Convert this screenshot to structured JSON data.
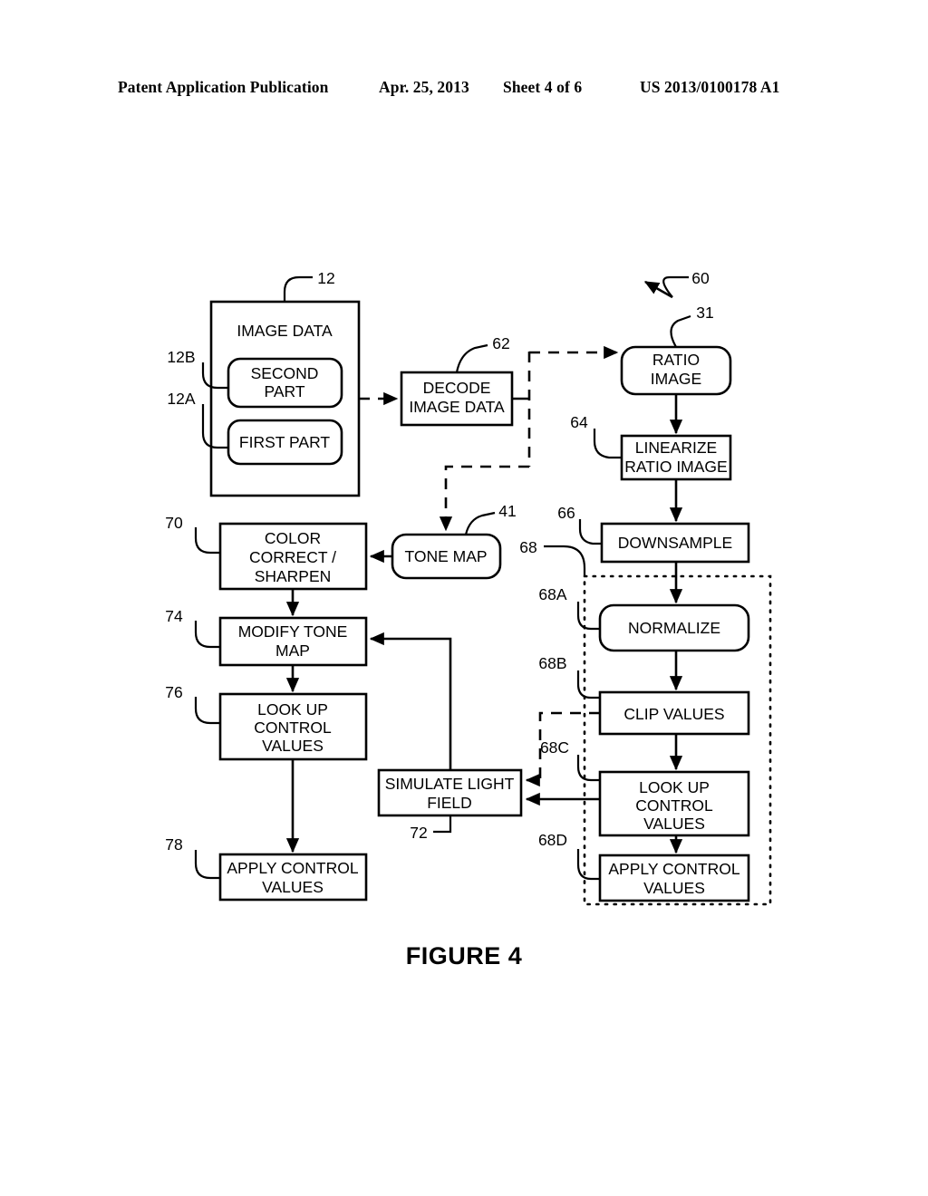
{
  "header": {
    "publication": "Patent Application Publication",
    "date": "Apr. 25, 2013",
    "sheet": "Sheet 4 of 6",
    "publication_number": "US 2013/0100178 A1"
  },
  "figure": {
    "caption": "FIGURE 4"
  },
  "diagram": {
    "type": "flowchart",
    "overall_reference": "60",
    "nodes": [
      {
        "id": "image_data",
        "label": "IMAGE DATA",
        "ref": "12",
        "shape": "rect"
      },
      {
        "id": "second_part",
        "label": "SECOND PART",
        "ref": "12B",
        "shape": "rounded"
      },
      {
        "id": "first_part",
        "label": "FIRST PART",
        "ref": "12A",
        "shape": "rounded"
      },
      {
        "id": "decode_image_data",
        "label": "DECODE IMAGE DATA",
        "ref": "62",
        "shape": "rect"
      },
      {
        "id": "ratio_image",
        "label": "RATIO IMAGE",
        "ref": "31",
        "shape": "rounded"
      },
      {
        "id": "linearize",
        "label": "LINEARIZE RATIO IMAGE",
        "ref": "64",
        "shape": "rect"
      },
      {
        "id": "downsample",
        "label": "DOWNSAMPLE",
        "ref": "66",
        "shape": "rect"
      },
      {
        "id": "normalize",
        "label": "NORMALIZE",
        "ref": "68A",
        "shape": "rounded"
      },
      {
        "id": "clip_values",
        "label": "CLIP VALUES",
        "ref": "68B",
        "shape": "rect"
      },
      {
        "id": "lookup_right",
        "label": "LOOK UP CONTROL VALUES",
        "ref": "68C",
        "shape": "rect"
      },
      {
        "id": "apply_right",
        "label": "APPLY CONTROL VALUES",
        "ref": "68D",
        "shape": "rect"
      },
      {
        "id": "tone_map",
        "label": "TONE MAP",
        "ref": "41",
        "shape": "rounded"
      },
      {
        "id": "color_correct",
        "label": "COLOR CORRECT / SHARPEN",
        "ref": "70",
        "shape": "rect"
      },
      {
        "id": "modify_tone_map",
        "label": "MODIFY TONE MAP",
        "ref": "74",
        "shape": "rect"
      },
      {
        "id": "lookup_left",
        "label": "LOOK UP CONTROL VALUES",
        "ref": "76",
        "shape": "rect"
      },
      {
        "id": "apply_left",
        "label": "APPLY CONTROL VALUES",
        "ref": "78",
        "shape": "rect"
      },
      {
        "id": "simulate_light",
        "label": "SIMULATE LIGHT FIELD",
        "ref": "72",
        "shape": "rect"
      }
    ],
    "group": {
      "id": "group_68",
      "ref": "68",
      "style": "dotted"
    },
    "text": {
      "image_data": "IMAGE DATA",
      "second_part_l1": "SECOND",
      "second_part_l2": "PART",
      "first_part": "FIRST PART",
      "decode_l1": "DECODE",
      "decode_l2": "IMAGE DATA",
      "ratio_l1": "RATIO",
      "ratio_l2": "IMAGE",
      "linearize_l1": "LINEARIZE",
      "linearize_l2": "RATIO IMAGE",
      "downsample": "DOWNSAMPLE",
      "normalize": "NORMALIZE",
      "clip_values": "CLIP VALUES",
      "lookup_r_l1": "LOOK UP",
      "lookup_r_l2": "CONTROL",
      "lookup_r_l3": "VALUES",
      "apply_r_l1": "APPLY CONTROL",
      "apply_r_l2": "VALUES",
      "tone_map": "TONE MAP",
      "color_l1": "COLOR",
      "color_l2": "CORRECT /",
      "color_l3": "SHARPEN",
      "modify_l1": "MODIFY TONE",
      "modify_l2": "MAP",
      "lookup_l_l1": "LOOK UP",
      "lookup_l_l2": "CONTROL",
      "lookup_l_l3": "VALUES",
      "apply_l_l1": "APPLY CONTROL",
      "apply_l_l2": "VALUES",
      "simulate_l1": "SIMULATE LIGHT",
      "simulate_l2": "FIELD"
    },
    "refs": {
      "r12": "12",
      "r12a": "12A",
      "r12b": "12B",
      "r31": "31",
      "r41": "41",
      "r60": "60",
      "r62": "62",
      "r64": "64",
      "r66": "66",
      "r68": "68",
      "r68a": "68A",
      "r68b": "68B",
      "r68c": "68C",
      "r68d": "68D",
      "r70": "70",
      "r72": "72",
      "r74": "74",
      "r76": "76",
      "r78": "78"
    }
  }
}
